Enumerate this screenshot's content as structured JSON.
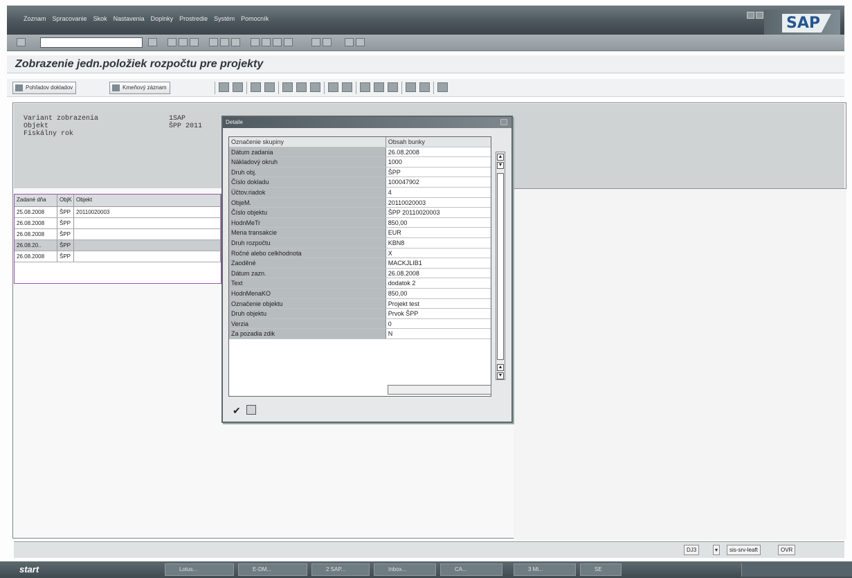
{
  "window": {
    "menu": [
      "Zoznam",
      "Spracovanie",
      "Skok",
      "Nastavenia",
      "Doplnky",
      "Prostredie",
      "Systém",
      "Pomocník"
    ],
    "brand": "SAP"
  },
  "page_title": "Zobrazenie jedn.položiek rozpočtu pre projekty",
  "toolbar": {
    "btn_doc": "Pohľadov dokladov",
    "btn_master": "Kmeňový záznam"
  },
  "header": {
    "rows": [
      {
        "label": "Variant zobrazenia",
        "value": "1SAP"
      },
      {
        "label": "Objekt",
        "value": "ŠPP 2011"
      },
      {
        "label": "Fiskálny rok",
        "value": ""
      }
    ]
  },
  "grid": {
    "columns": [
      "Zadané dňa",
      "ObjK",
      "Objekt"
    ],
    "rows": [
      {
        "date": "25.08.2008",
        "type": "ŠPP",
        "obj": "20110020003"
      },
      {
        "date": "26.08.2008",
        "type": "ŠPP",
        "obj": ""
      },
      {
        "date": "26.08.2008",
        "type": "ŠPP",
        "obj": ""
      },
      {
        "date": "26.08.20..",
        "type": "ŠPP",
        "obj": ""
      },
      {
        "date": "26.08.2008",
        "type": "ŠPP",
        "obj": ""
      }
    ],
    "selected_row": 3
  },
  "dialog": {
    "title": "Detaile",
    "columns": [
      "Označenie skupiny",
      "Obsah bunky"
    ],
    "rows": [
      {
        "k": "Dátum zadania",
        "v": "26.08.2008"
      },
      {
        "k": "Nákladový okruh",
        "v": "1000"
      },
      {
        "k": "Druh obj.",
        "v": "ŠPP"
      },
      {
        "k": "Číslo dokladu",
        "v": "100047902"
      },
      {
        "k": "Účtov.riadok",
        "v": "4"
      },
      {
        "k": "ObjeM.",
        "v": "20110020003"
      },
      {
        "k": "Číslo objektu",
        "v": "ŠPP 20110020003"
      },
      {
        "k": "HodnMeTr",
        "v": "850,00"
      },
      {
        "k": "Mena transakcie",
        "v": "EUR"
      },
      {
        "k": "Druh rozpočtu",
        "v": "KBN8"
      },
      {
        "k": "Ročné alebo celkhodnota",
        "v": "X"
      },
      {
        "k": "Zaoděné",
        "v": "MACKJLIB1"
      },
      {
        "k": "Dátum zazn.",
        "v": "26.08.2008"
      },
      {
        "k": "Text",
        "v": "dodatok 2"
      },
      {
        "k": "HodnMenaKO",
        "v": "850,00"
      },
      {
        "k": "Označenie objektu",
        "v": "Projekt test"
      },
      {
        "k": "Druh objektu",
        "v": "Prvok ŠPP"
      },
      {
        "k": "Verzia",
        "v": "0"
      },
      {
        "k": "Za pozadia zdik",
        "v": "N"
      }
    ]
  },
  "status": {
    "system": "DJ3",
    "server": "sis-srv-leaft",
    "mode": "OVR"
  },
  "taskbar": {
    "start": "start",
    "tasks": [
      "Lotus...",
      "E-DM...",
      "2 SAP...",
      "Inbox...",
      "CA...",
      "3 Mi...",
      "SE"
    ]
  }
}
